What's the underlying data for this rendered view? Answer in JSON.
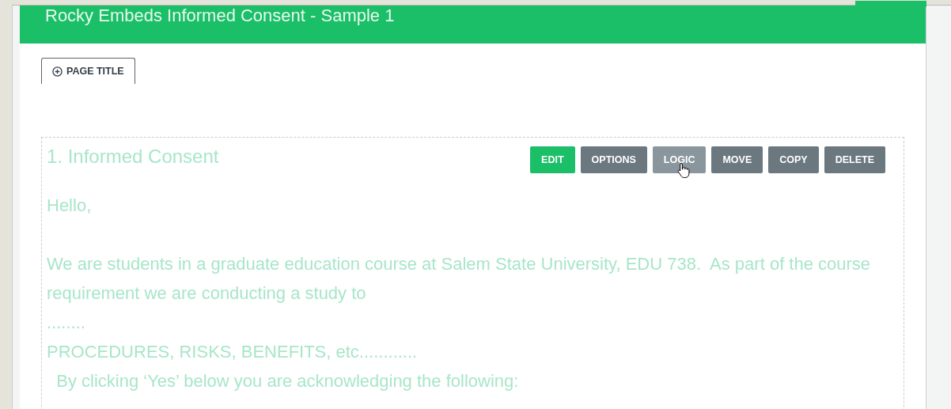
{
  "survey": {
    "title": "Rocky Embeds Informed Consent - Sample 1"
  },
  "page_title_button": {
    "label": "PAGE TITLE"
  },
  "question": {
    "title": "1. Informed Consent",
    "actions": [
      {
        "label": "EDIT",
        "kind": "primary",
        "hovered": false
      },
      {
        "label": "OPTIONS",
        "kind": "secondary",
        "hovered": false
      },
      {
        "label": "LOGIC",
        "kind": "secondary",
        "hovered": true
      },
      {
        "label": "MOVE",
        "kind": "secondary",
        "hovered": false
      },
      {
        "label": "COPY",
        "kind": "secondary",
        "hovered": false
      },
      {
        "label": "DELETE",
        "kind": "secondary",
        "hovered": false
      }
    ],
    "paragraphs": [
      "Hello,",
      "We are students in a graduate education course at Salem State University, EDU 738.  As part of the course requirement we are conducting a study to",
      "........",
      "PROCEDURES, RISKS, BENEFITS, etc............",
      "  By clicking ‘Yes’ below you are acknowledging the following:"
    ]
  }
}
